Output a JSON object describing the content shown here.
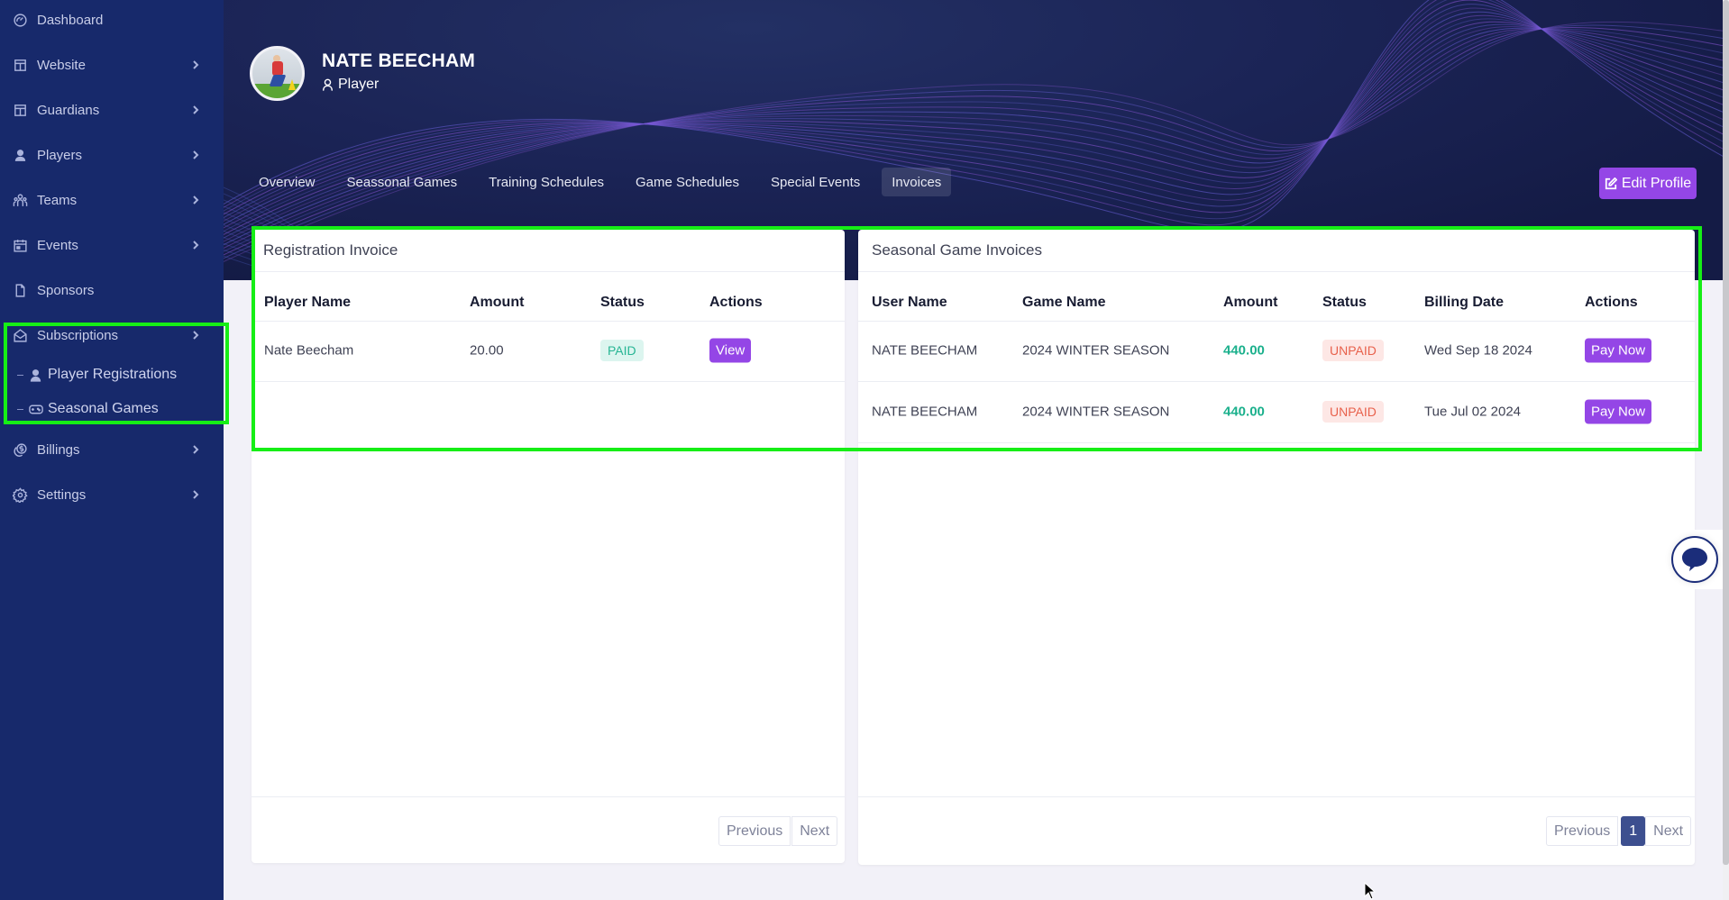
{
  "sidebar": {
    "items": [
      {
        "label": "Dashboard",
        "icon": "dashboard-gauge-icon",
        "has_children": false
      },
      {
        "label": "Website",
        "icon": "layout-icon",
        "has_children": true
      },
      {
        "label": "Guardians",
        "icon": "layout-icon",
        "has_children": true
      },
      {
        "label": "Players",
        "icon": "user-icon",
        "has_children": true
      },
      {
        "label": "Teams",
        "icon": "team-icon",
        "has_children": true
      },
      {
        "label": "Events",
        "icon": "calendar-icon",
        "has_children": true
      },
      {
        "label": "Sponsors",
        "icon": "document-icon",
        "has_children": false
      },
      {
        "label": "Subscriptions",
        "icon": "envelope-open-icon",
        "has_children": true,
        "expanded": true
      },
      {
        "label": "Billings",
        "icon": "coins-icon",
        "has_children": true
      },
      {
        "label": "Settings",
        "icon": "gear-icon",
        "has_children": true
      }
    ],
    "subscriptions_children": [
      {
        "label": "Player Registrations",
        "icon": "user-icon"
      },
      {
        "label": "Seasonal Games",
        "icon": "gamepad-icon"
      }
    ]
  },
  "profile": {
    "name": "NATE BEECHAM",
    "role": "Player",
    "edit_label": "Edit Profile"
  },
  "tabs": [
    {
      "label": "Overview",
      "active": false
    },
    {
      "label": "Seassonal Games",
      "active": false
    },
    {
      "label": "Training Schedules",
      "active": false
    },
    {
      "label": "Game Schedules",
      "active": false
    },
    {
      "label": "Special Events",
      "active": false
    },
    {
      "label": "Invoices",
      "active": true
    }
  ],
  "registration_invoice": {
    "title": "Registration Invoice",
    "columns": [
      "Player Name",
      "Amount",
      "Status",
      "Actions"
    ],
    "rows": [
      {
        "player_name": "Nate Beecham",
        "amount": "20.00",
        "status": "PAID",
        "action": "View"
      }
    ],
    "pagination": {
      "previous": "Previous",
      "next": "Next"
    }
  },
  "seasonal_invoices": {
    "title": "Seasonal Game Invoices",
    "columns": [
      "User Name",
      "Game Name",
      "Amount",
      "Status",
      "Billing Date",
      "Actions"
    ],
    "rows": [
      {
        "user_name": "NATE BEECHAM",
        "game_name": "2024 WINTER SEASON",
        "amount": "440.00",
        "status": "UNPAID",
        "billing_date": "Wed Sep 18 2024",
        "action": "Pay Now"
      },
      {
        "user_name": "NATE BEECHAM",
        "game_name": "2024 WINTER SEASON",
        "amount": "440.00",
        "status": "UNPAID",
        "billing_date": "Tue Jul 02 2024",
        "action": "Pay Now"
      }
    ],
    "pagination": {
      "previous": "Previous",
      "current_page": "1",
      "next": "Next"
    }
  },
  "colors": {
    "sidebar_bg": "#17296b",
    "accent_purple": "#9446e6",
    "paid_green": "#27b594",
    "unpaid_red": "#e8614c",
    "amount_green": "#1bb08c",
    "highlight": "#16ee16"
  }
}
